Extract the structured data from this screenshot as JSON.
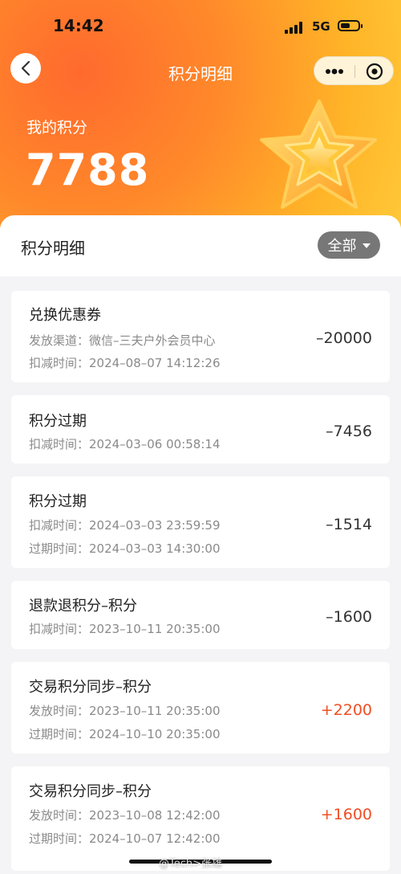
{
  "status": {
    "time": "14:42",
    "network": "5G"
  },
  "nav": {
    "title": "积分明细"
  },
  "summary": {
    "label": "我的积分",
    "value": "7788"
  },
  "list_header": {
    "title": "积分明细",
    "filter_label": "全部"
  },
  "records": [
    {
      "title": "兑换优惠券",
      "lines": [
        "发放渠道：微信–三夫户外会员中心",
        "扣减时间：2024–08–07 14:12:26"
      ],
      "amount": "–20000",
      "positive": false
    },
    {
      "title": "积分过期",
      "lines": [
        "扣减时间：2024–03–06 00:58:14"
      ],
      "amount": "–7456",
      "positive": false
    },
    {
      "title": "积分过期",
      "lines": [
        "扣减时间：2024–03–03 23:59:59",
        "过期时间：2024–03–03 14:30:00"
      ],
      "amount": "–1514",
      "positive": false
    },
    {
      "title": "退款退积分–积分",
      "lines": [
        "扣减时间：2023–10–11 20:35:00"
      ],
      "amount": "–1600",
      "positive": false
    },
    {
      "title": "交易积分同步–积分",
      "lines": [
        "发放时间：2023–10–11 20:35:00",
        "过期时间：2024–10–10 20:35:00"
      ],
      "amount": "+2200",
      "positive": true
    },
    {
      "title": "交易积分同步–积分",
      "lines": [
        "发放时间：2023–10–08 12:42:00",
        "过期时间：2024–10–07 12:42:00"
      ],
      "amount": "+1600",
      "positive": true
    }
  ],
  "watermark": "@Tech>张雄",
  "colors": {
    "positive": "#f04e23",
    "header_orange": "#ff7a2b",
    "header_yellow": "#ffc93a",
    "filter_bg": "#777777"
  },
  "icons": [
    "back-icon",
    "more-icon",
    "target-icon",
    "star-icon",
    "caret-down-icon"
  ]
}
